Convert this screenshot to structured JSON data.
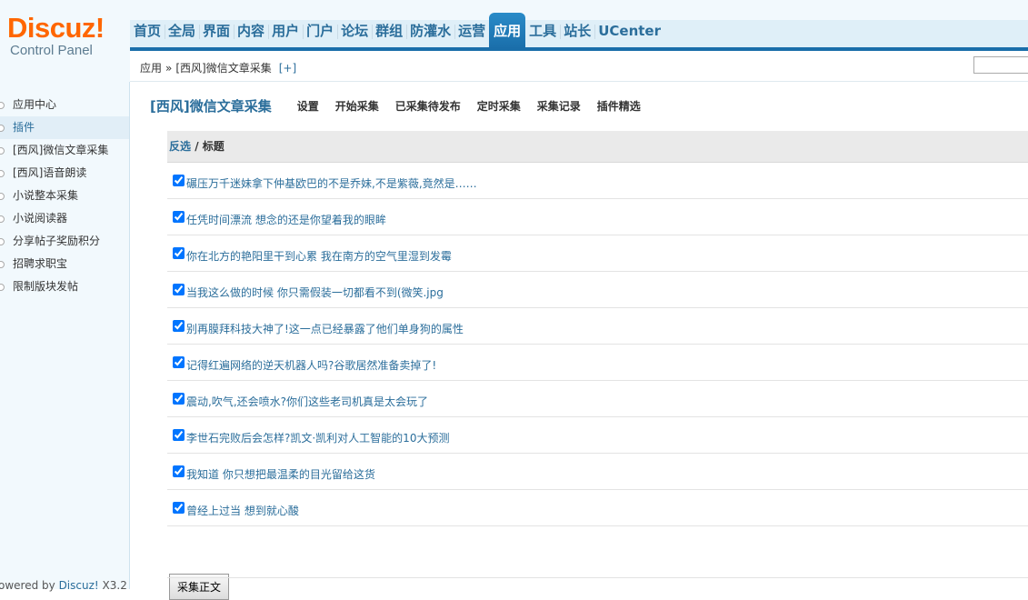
{
  "logo": {
    "brand": "Discuz",
    "bang": "!",
    "subtitle": "Control Panel"
  },
  "topnav": [
    {
      "label": "首页",
      "active": false
    },
    {
      "label": "全局",
      "active": false
    },
    {
      "label": "界面",
      "active": false
    },
    {
      "label": "内容",
      "active": false
    },
    {
      "label": "用户",
      "active": false
    },
    {
      "label": "门户",
      "active": false
    },
    {
      "label": "论坛",
      "active": false
    },
    {
      "label": "群组",
      "active": false
    },
    {
      "label": "防灌水",
      "active": false
    },
    {
      "label": "运营",
      "active": false
    },
    {
      "label": "应用",
      "active": true
    },
    {
      "label": "工具",
      "active": false
    },
    {
      "label": "站长",
      "active": false
    },
    {
      "label": "UCenter",
      "active": false
    }
  ],
  "breadcrumb": {
    "root": "应用",
    "separator": "»",
    "current": "[西风]微信文章采集",
    "add": "[+]"
  },
  "sidebar": {
    "items": [
      {
        "label": "应用中心",
        "active": false
      },
      {
        "label": "插件",
        "active": true
      },
      {
        "label": "[西风]微信文章采集",
        "active": false
      },
      {
        "label": "[西风]语音朗读",
        "active": false
      },
      {
        "label": "小说整本采集",
        "active": false
      },
      {
        "label": "小说阅读器",
        "active": false
      },
      {
        "label": "分享帖子奖励积分",
        "active": false
      },
      {
        "label": "招聘求职宝",
        "active": false
      },
      {
        "label": "限制版块发帖",
        "active": false
      }
    ],
    "powered_prefix": "owered by ",
    "powered_link": "Discuz!",
    "powered_version": " X3.2"
  },
  "plugin": {
    "title": "[西风]微信文章采集",
    "tabs": [
      "设置",
      "开始采集",
      "已采集待发布",
      "定时采集",
      "采集记录",
      "插件精选"
    ]
  },
  "table": {
    "header_toggle": "反选",
    "header_sep": " / ",
    "header_title": "标题",
    "rows": [
      {
        "title": "碾压万千迷妹拿下仲基欧巴的不是乔妹,不是紫薇,竟然是……",
        "checked": true
      },
      {
        "title": "任凭时间漂流 想念的还是你望着我的眼眸",
        "checked": true
      },
      {
        "title": "你在北方的艳阳里干到心累 我在南方的空气里湿到发霉",
        "checked": true
      },
      {
        "title": "当我这么做的时候 你只需假装一切都看不到(微笑.jpg",
        "checked": true
      },
      {
        "title": "别再膜拜科技大神了!这一点已经暴露了他们单身狗的属性",
        "checked": true
      },
      {
        "title": "记得红遍网络的逆天机器人吗?谷歌居然准备卖掉了!",
        "checked": true
      },
      {
        "title": "震动,吹气,还会喷水?你们这些老司机真是太会玩了",
        "checked": true
      },
      {
        "title": "李世石完败后会怎样?凯文·凯利对人工智能的10大预测",
        "checked": true
      },
      {
        "title": "我知道 你只想把最温柔的目光留给这货",
        "checked": true
      },
      {
        "title": "曾经上过当 想到就心酸",
        "checked": true
      }
    ],
    "submit_label": "采集正文"
  },
  "colors": {
    "brand_orange": "#ff6600",
    "link_blue": "#2b6e9b",
    "nav_active": "#1a6eaa"
  }
}
